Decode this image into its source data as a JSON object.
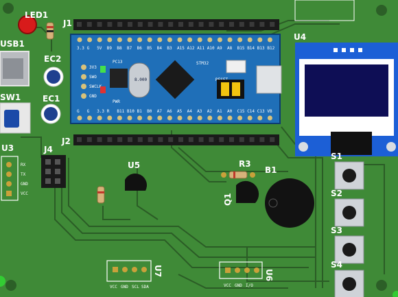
{
  "colors": {
    "board": "#3f8a37",
    "board_dark": "#2c5f27",
    "silk": "#ffffff",
    "trace": "#2b5c26",
    "mcu_pcb": "#1f6fb8",
    "oled_frame": "#1c5fd6",
    "header": "#1a1a1a",
    "pad": "#c9a13a"
  },
  "labels": {
    "led1": "LED1",
    "usb1": "USB1",
    "ec2": "EC2",
    "sw1": "SW1",
    "ec1": "EC1",
    "u3": "U3",
    "j4": "J4",
    "j1": "J1",
    "j2": "J2",
    "u4": "U4",
    "u5": "U5",
    "r3": "R3",
    "b1": "B1",
    "q1": "Q1",
    "u7": "U7",
    "u6": "U6",
    "s1": "S1",
    "s2": "S2",
    "s3": "S3",
    "s4": "S4"
  },
  "mcu": {
    "chip_name": "STM32",
    "crystal": "8.000",
    "reset": "RESET",
    "pwr": "PWR",
    "pc13": "PC13",
    "row_top": [
      "G",
      "G",
      "3.3",
      "R",
      "B11",
      "B10",
      "B1",
      "B0",
      "A7",
      "A6",
      "A5",
      "A4",
      "A3",
      "A2",
      "A1",
      "A0",
      "C15",
      "C14",
      "C13",
      "VB"
    ],
    "row_bot": [
      "B12",
      "B13",
      "B14",
      "B15",
      "A8",
      "A9",
      "A10",
      "A11",
      "A12",
      "A15",
      "B3",
      "B4",
      "B5",
      "B6",
      "B7",
      "B8",
      "B9",
      "5V",
      "G",
      "3.3"
    ],
    "debug": [
      "3V3",
      "SWO",
      "SWCLK",
      "GND"
    ],
    "boot": [
      "0",
      "1"
    ]
  },
  "u3_pins": [
    "RX",
    "TX",
    "GND",
    "VCC"
  ],
  "u7_pins": [
    "VCC",
    "GND",
    "SCL",
    "SDA"
  ],
  "u6_pins": [
    "VCC",
    "GND",
    "I/O"
  ]
}
